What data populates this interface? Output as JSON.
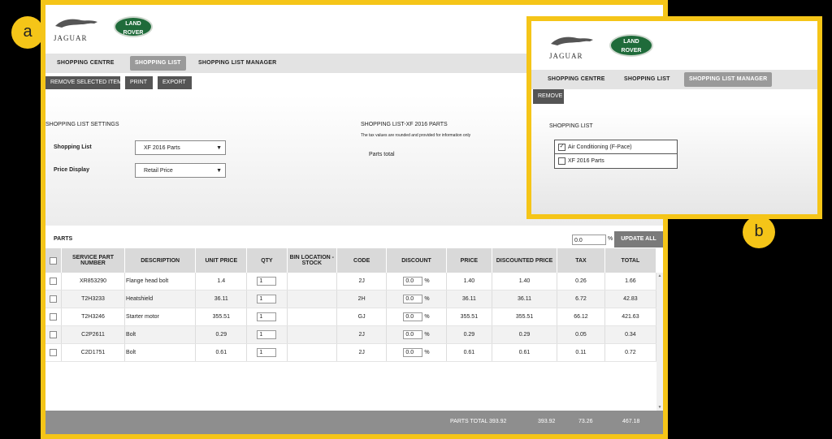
{
  "badges": {
    "a": "a",
    "b": "b"
  },
  "brand": {
    "jaguar": "JAGUAR",
    "land_rover_1": "LAND",
    "land_rover_2": "ROVER"
  },
  "panel_a": {
    "nav": [
      "SHOPPING CENTRE",
      "SHOPPING LIST",
      "SHOPPING LIST MANAGER"
    ],
    "active_nav": 1,
    "toolbar": {
      "remove": "REMOVE SELECTED ITEMS",
      "print": "PRINT",
      "export": "EXPORT"
    },
    "settings_title": "SHOPPING LIST SETTINGS",
    "shopping_list_label": "Shopping List",
    "shopping_list_value": "XF 2016 Parts",
    "price_display_label": "Price Display",
    "price_display_value": "Retail Price",
    "parts_title": "SHOPPING LIST-XF 2016 PARTS",
    "tax_note": "The tax values are rounded and provided for information only",
    "parts_total_label": "Parts total",
    "parts_label": "PARTS",
    "bulk_discount": "0.0",
    "percent": "%",
    "update_all": "UPDATE ALL",
    "columns": [
      "SERVICE PART NUMBER",
      "DESCRIPTION",
      "UNIT PRICE",
      "QTY",
      "BIN LOCATION - STOCK",
      "CODE",
      "DISCOUNT",
      "PRICE",
      "DISCOUNTED PRICE",
      "TAX",
      "TOTAL"
    ],
    "rows": [
      {
        "part": "XR853290",
        "desc": "Flange head bolt",
        "unit": "1.4",
        "qty": "1",
        "bin": "",
        "code": "2J",
        "disc": "0.0",
        "price": "1.40",
        "dprice": "1.40",
        "tax": "0.26",
        "total": "1.66"
      },
      {
        "part": "T2H3233",
        "desc": "Heatshield",
        "unit": "36.11",
        "qty": "1",
        "bin": "",
        "code": "2H",
        "disc": "0.0",
        "price": "36.11",
        "dprice": "36.11",
        "tax": "6.72",
        "total": "42.83"
      },
      {
        "part": "T2H3246",
        "desc": "Starter motor",
        "unit": "355.51",
        "qty": "1",
        "bin": "",
        "code": "GJ",
        "disc": "0.0",
        "price": "355.51",
        "dprice": "355.51",
        "tax": "66.12",
        "total": "421.63"
      },
      {
        "part": "C2P2611",
        "desc": "Bolt",
        "unit": "0.29",
        "qty": "1",
        "bin": "",
        "code": "2J",
        "disc": "0.0",
        "price": "0.29",
        "dprice": "0.29",
        "tax": "0.05",
        "total": "0.34"
      },
      {
        "part": "C2D1751",
        "desc": "Bolt",
        "unit": "0.61",
        "qty": "1",
        "bin": "",
        "code": "2J",
        "disc": "0.0",
        "price": "0.61",
        "dprice": "0.61",
        "tax": "0.11",
        "total": "0.72"
      }
    ],
    "totals": {
      "label": "PARTS TOTAL",
      "price": "393.92",
      "dprice": "393.92",
      "tax": "73.26",
      "total": "467.18"
    }
  },
  "panel_b": {
    "nav": [
      "SHOPPING CENTRE",
      "SHOPPING LIST",
      "SHOPPING LIST MANAGER"
    ],
    "active_nav": 2,
    "remove": "REMOVE",
    "list_title": "SHOPPING LIST",
    "lists": [
      {
        "name": "Air Conditioning (F-Pace)",
        "checked": true
      },
      {
        "name": "XF 2016 Parts",
        "checked": false
      }
    ]
  },
  "colors": {
    "accent": "#f5c518",
    "dark_button": "#555555",
    "nav_bg": "#e3e3e3",
    "footer_bg": "#8e8e8e"
  }
}
